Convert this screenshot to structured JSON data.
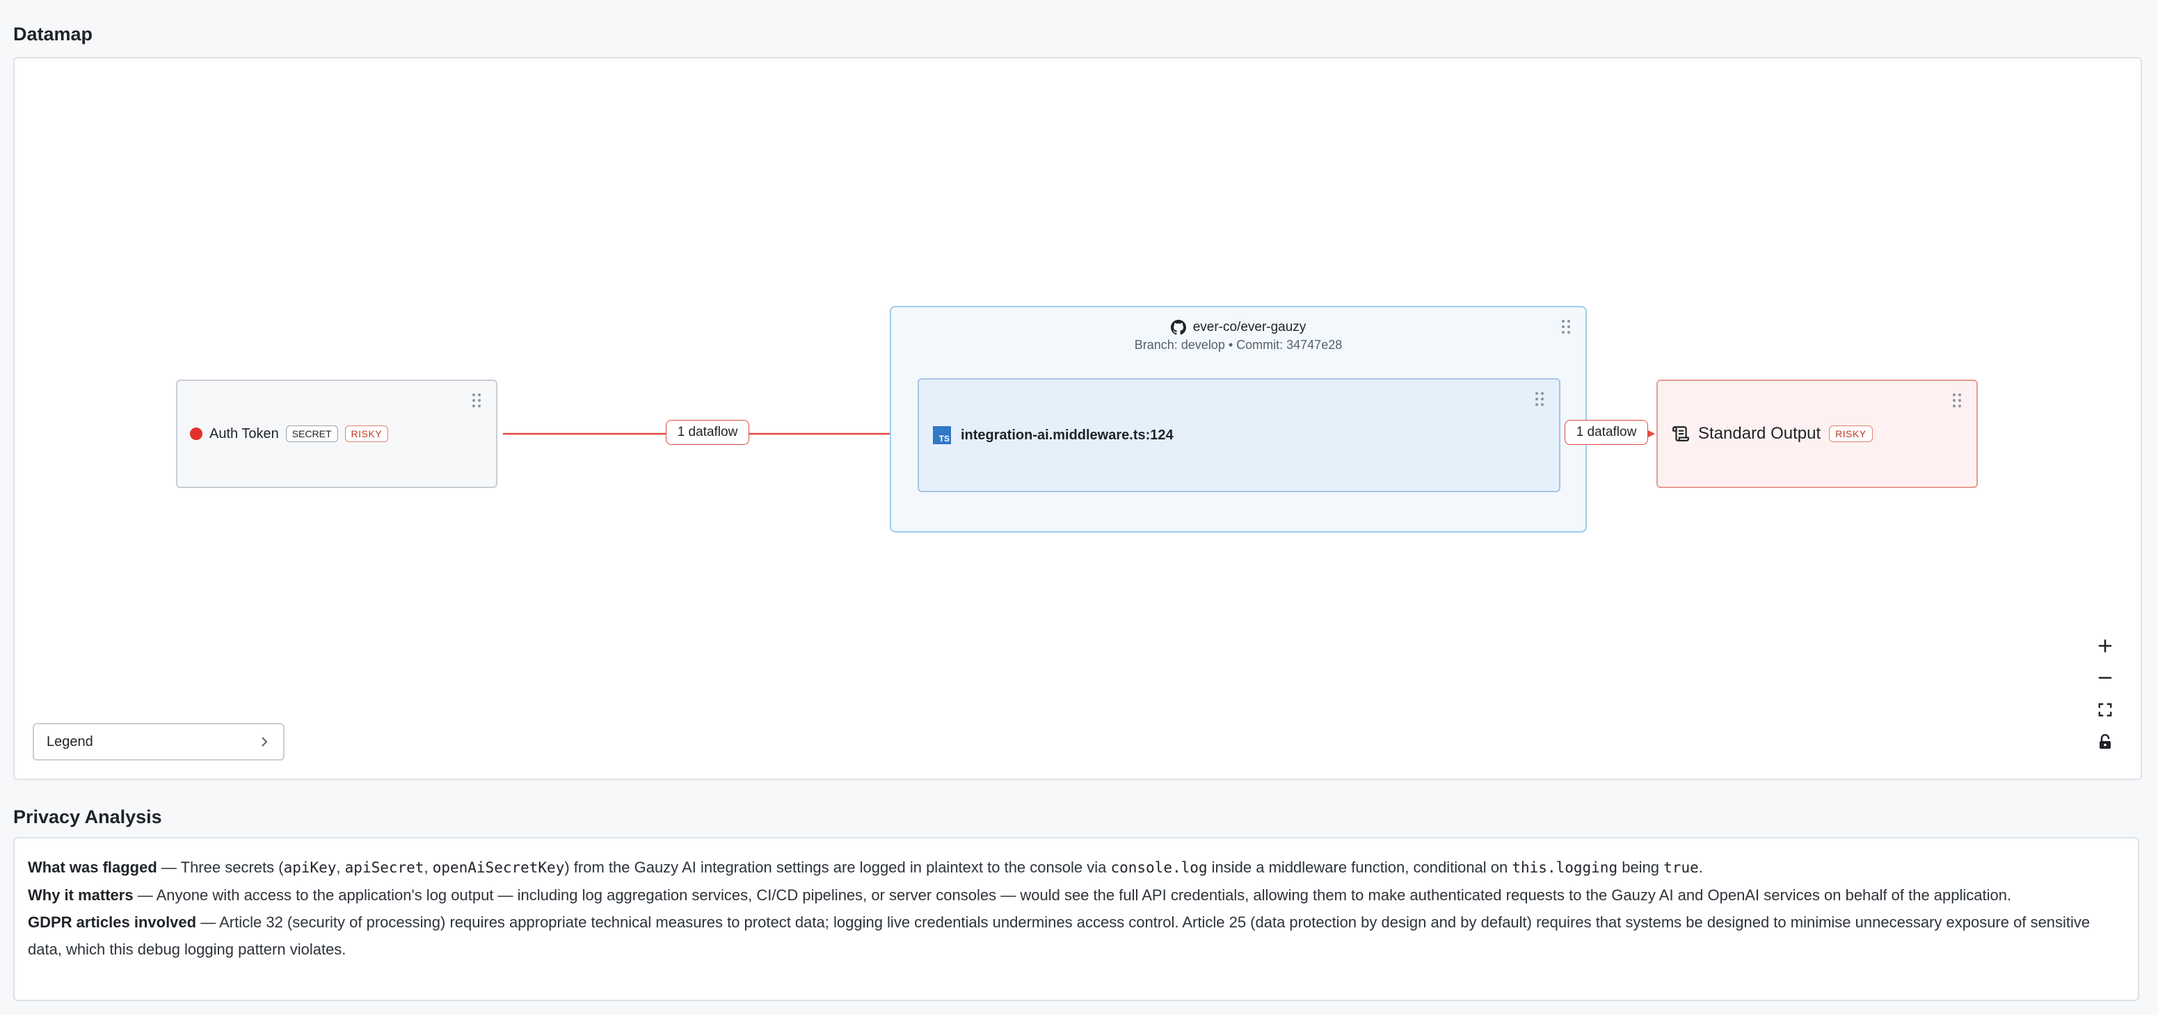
{
  "datamap": {
    "title": "Datamap",
    "source_node": {
      "label": "Auth Token",
      "badges": [
        "SECRET",
        "RISKY"
      ],
      "status_color": "#e5302a"
    },
    "repo_group": {
      "repo": "ever-co/ever-gauzy",
      "meta": "Branch: develop • Commit: 34747e28",
      "file_node": {
        "icon_text": "TS",
        "label": "integration-ai.middleware.ts:124"
      }
    },
    "sink_node": {
      "label": "Standard Output",
      "badge": "RISKY"
    },
    "edges": [
      {
        "label": "1 dataflow"
      },
      {
        "label": "1 dataflow"
      }
    ],
    "controls": [
      "zoom-in",
      "zoom-out",
      "fit-view",
      "lock"
    ],
    "legend": {
      "label": "Legend"
    },
    "edge_color": "#e24b3d"
  },
  "privacy": {
    "title": "Privacy Analysis",
    "what": {
      "label": "What was flagged",
      "t1": " — Three secrets (",
      "c1": "apiKey",
      "t2": ", ",
      "c2": "apiSecret",
      "t3": ", ",
      "c3": "openAiSecretKey",
      "t4": ") from the Gauzy AI integration settings are logged in plaintext to the console via ",
      "c4": "console.log",
      "t5": " inside a middleware function, conditional on ",
      "c5": "this.logging",
      "t6": " being ",
      "c6": "true",
      "t7": "."
    },
    "why": {
      "label": "Why it matters",
      "text": " — Anyone with access to the application's log output — including log aggregation services, CI/CD pipelines, or server consoles — would see the full API credentials, allowing them to make authenticated requests to the Gauzy AI and OpenAI services on behalf of the application."
    },
    "gdpr": {
      "label": "GDPR articles involved",
      "text": " — Article 32 (security of processing) requires appropriate technical measures to protect data; logging live credentials undermines access control. Article 25 (data protection by design and by default) requires that systems be designed to minimise unnecessary exposure of sensitive data, which this debug logging pattern violates."
    }
  }
}
